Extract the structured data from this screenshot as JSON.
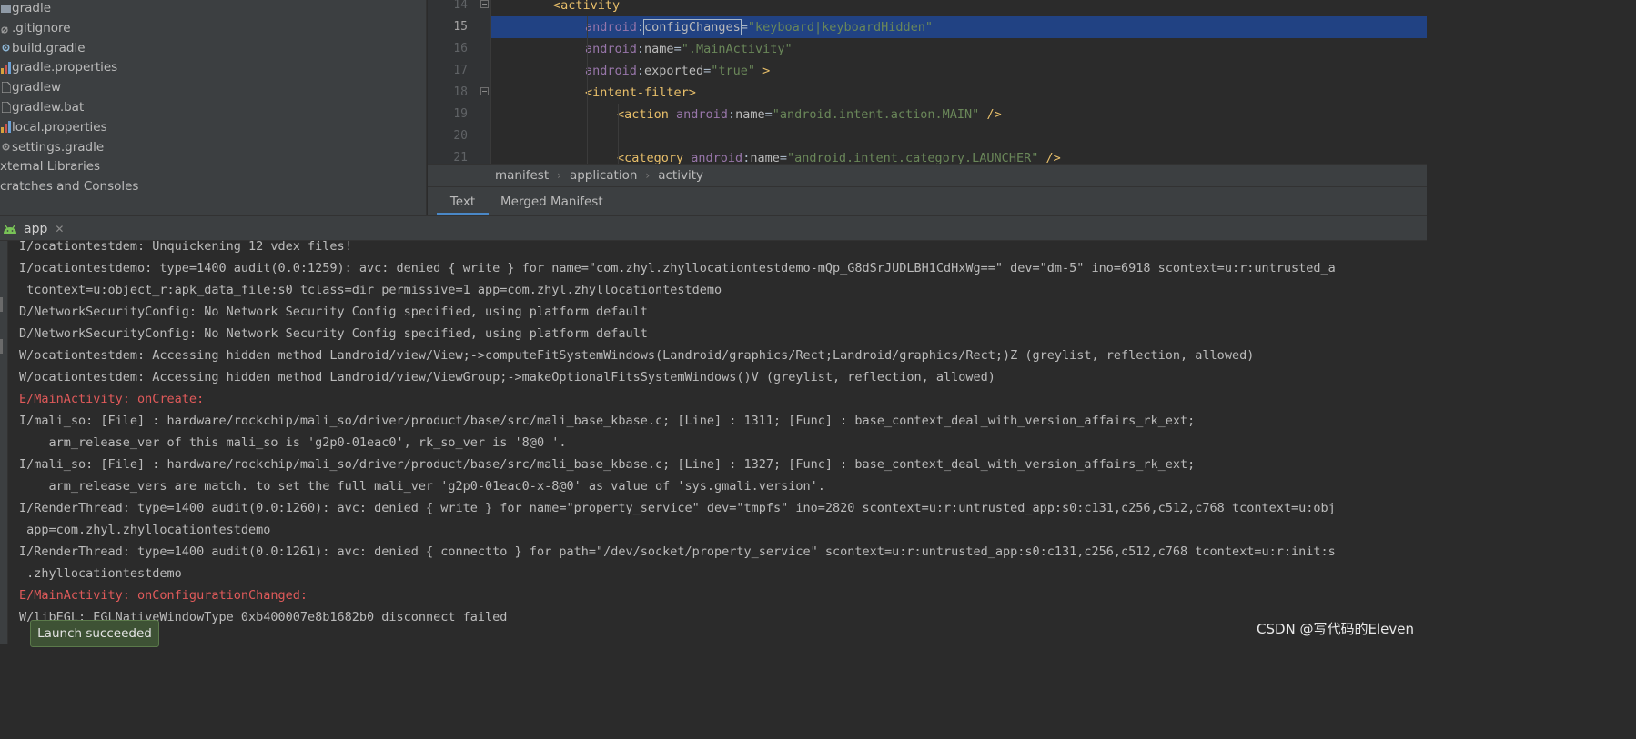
{
  "project_tree": {
    "items": [
      {
        "label": "gradle",
        "icon": "folder-icon",
        "color": "#8f9aa6"
      },
      {
        "label": ".gitignore",
        "icon": "file-ignore-icon",
        "color": "#9a9a9a"
      },
      {
        "label": "build.gradle",
        "icon": "gradle-file-icon",
        "color": "#8fb8d8"
      },
      {
        "label": "gradle.properties",
        "icon": "properties-file-icon",
        "color": "#d7a23c"
      },
      {
        "label": "gradlew",
        "icon": "text-file-icon",
        "color": "#9a9a9a"
      },
      {
        "label": "gradlew.bat",
        "icon": "text-file-icon",
        "color": "#9a9a9a"
      },
      {
        "label": "local.properties",
        "icon": "properties-file-icon",
        "color": "#d7a23c"
      },
      {
        "label": "settings.gradle",
        "icon": "gradle-settings-icon",
        "color": "#9a9a9a"
      },
      {
        "label": "xternal Libraries",
        "icon": "libraries-icon",
        "color": ""
      },
      {
        "label": "cratches and Consoles",
        "icon": "scratches-icon",
        "color": ""
      }
    ]
  },
  "editor": {
    "lines": [
      {
        "number": "14",
        "tokens": [
          {
            "t": "<activity",
            "c": "tag"
          }
        ]
      },
      {
        "number": "15",
        "tokens": [
          {
            "t": "android",
            "c": "ns"
          },
          {
            "t": ":",
            "c": "punct"
          },
          {
            "t": "configChanges",
            "c": "attr",
            "sel": true
          },
          {
            "t": "=",
            "c": "punct"
          },
          {
            "t": "\"keyboard|keyboardHidden\"",
            "c": "val"
          }
        ]
      },
      {
        "number": "16",
        "tokens": [
          {
            "t": "android",
            "c": "ns"
          },
          {
            "t": ":",
            "c": "punct"
          },
          {
            "t": "name",
            "c": "attr"
          },
          {
            "t": "=",
            "c": "punct"
          },
          {
            "t": "\".MainActivity\"",
            "c": "val"
          }
        ]
      },
      {
        "number": "17",
        "tokens": [
          {
            "t": "android",
            "c": "ns"
          },
          {
            "t": ":",
            "c": "punct"
          },
          {
            "t": "exported",
            "c": "attr"
          },
          {
            "t": "=",
            "c": "punct"
          },
          {
            "t": "\"true\"",
            "c": "val"
          },
          {
            "t": " >",
            "c": "tag"
          }
        ]
      },
      {
        "number": "18",
        "tokens": [
          {
            "t": "<intent-filter>",
            "c": "tag"
          }
        ]
      },
      {
        "number": "19",
        "tokens": [
          {
            "t": "<action ",
            "c": "tag"
          },
          {
            "t": "android",
            "c": "ns"
          },
          {
            "t": ":",
            "c": "punct"
          },
          {
            "t": "name",
            "c": "attr"
          },
          {
            "t": "=",
            "c": "punct"
          },
          {
            "t": "\"android.intent.action.MAIN\"",
            "c": "val"
          },
          {
            "t": " />",
            "c": "tag"
          }
        ]
      },
      {
        "number": "20",
        "tokens": []
      },
      {
        "number": "21",
        "tokens": [
          {
            "t": "<category ",
            "c": "tag"
          },
          {
            "t": "android",
            "c": "ns"
          },
          {
            "t": ":",
            "c": "punct"
          },
          {
            "t": "name",
            "c": "attr"
          },
          {
            "t": "=",
            "c": "punct"
          },
          {
            "t": "\"android.intent.category.LAUNCHER\"",
            "c": "val"
          },
          {
            "t": " />",
            "c": "tag"
          }
        ]
      }
    ],
    "current_line": "15",
    "breadcrumbs": [
      "manifest",
      "application",
      "activity"
    ],
    "tabs": [
      "Text",
      "Merged Manifest"
    ],
    "active_tab": "Text"
  },
  "run_panel": {
    "tab_label": "app",
    "tab_icon": "android-icon",
    "log_lines": [
      {
        "text": "I/ocationtestdem: Unquickening 12 vdex files!",
        "level": "info"
      },
      {
        "text": "I/ocationtestdemo: type=1400 audit(0.0:1259): avc: denied { write } for name=\"com.zhyl.zhyllocationtestdemo-mQp_G8dSrJUDLBH1CdHxWg==\" dev=\"dm-5\" ino=6918 scontext=u:r:untrusted_a",
        "level": "info"
      },
      {
        "text": " tcontext=u:object_r:apk_data_file:s0 tclass=dir permissive=1 app=com.zhyl.zhyllocationtestdemo",
        "level": "info"
      },
      {
        "text": "D/NetworkSecurityConfig: No Network Security Config specified, using platform default",
        "level": "info"
      },
      {
        "text": "D/NetworkSecurityConfig: No Network Security Config specified, using platform default",
        "level": "info"
      },
      {
        "text": "W/ocationtestdem: Accessing hidden method Landroid/view/View;->computeFitSystemWindows(Landroid/graphics/Rect;Landroid/graphics/Rect;)Z (greylist, reflection, allowed)",
        "level": "info"
      },
      {
        "text": "W/ocationtestdem: Accessing hidden method Landroid/view/ViewGroup;->makeOptionalFitsSystemWindows()V (greylist, reflection, allowed)",
        "level": "info"
      },
      {
        "text": "E/MainActivity: onCreate:",
        "level": "error"
      },
      {
        "text": "I/mali_so: [File] : hardware/rockchip/mali_so/driver/product/base/src/mali_base_kbase.c; [Line] : 1311; [Func] : base_context_deal_with_version_affairs_rk_ext;",
        "level": "info"
      },
      {
        "text": "    arm_release_ver of this mali_so is 'g2p0-01eac0', rk_so_ver is '8@0 '.",
        "level": "info"
      },
      {
        "text": "I/mali_so: [File] : hardware/rockchip/mali_so/driver/product/base/src/mali_base_kbase.c; [Line] : 1327; [Func] : base_context_deal_with_version_affairs_rk_ext;",
        "level": "info"
      },
      {
        "text": "    arm_release_vers are match. to set the full mali_ver 'g2p0-01eac0-x-8@0' as value of 'sys.gmali.version'.",
        "level": "info"
      },
      {
        "text": "I/RenderThread: type=1400 audit(0.0:1260): avc: denied { write } for name=\"property_service\" dev=\"tmpfs\" ino=2820 scontext=u:r:untrusted_app:s0:c131,c256,c512,c768 tcontext=u:obj",
        "level": "info"
      },
      {
        "text": " app=com.zhyl.zhyllocationtestdemo",
        "level": "info"
      },
      {
        "text": "I/RenderThread: type=1400 audit(0.0:1261): avc: denied { connectto } for path=\"/dev/socket/property_service\" scontext=u:r:untrusted_app:s0:c131,c256,c512,c768 tcontext=u:r:init:s",
        "level": "info"
      },
      {
        "text": " .zhyllocationtestdemo",
        "level": "info"
      },
      {
        "text": "E/MainActivity: onConfigurationChanged:",
        "level": "error"
      },
      {
        "text": "W/libEGL: EGLNativeWindowType 0xb400007e8b1682b0 disconnect failed",
        "level": "info"
      }
    ]
  },
  "toast": {
    "label": "Launch succeeded"
  },
  "watermark": {
    "text": "CSDN @写代码的Eleven"
  },
  "colors": {
    "tag": "#e8bf6a",
    "namespace": "#9876aa",
    "value": "#6a8759",
    "selection_line": "#214283",
    "error_log": "#e05a5a",
    "toast_bg": "#3e5235"
  }
}
